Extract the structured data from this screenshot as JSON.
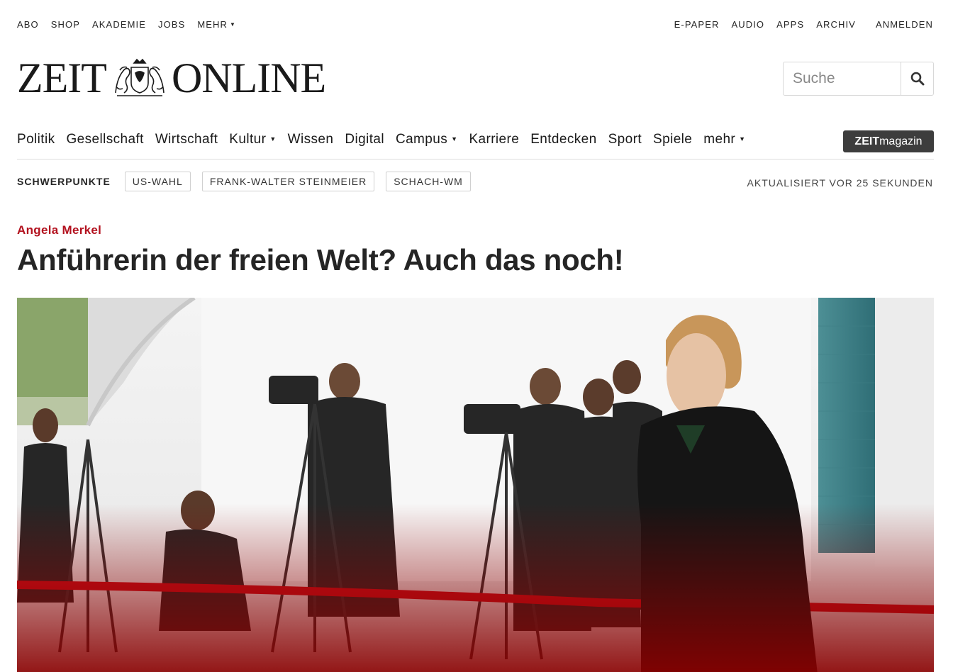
{
  "topbar": {
    "left": [
      "ABO",
      "SHOP",
      "AKADEMIE",
      "JOBS",
      "MEHR"
    ],
    "right": [
      "E-PAPER",
      "AUDIO",
      "APPS",
      "ARCHIV"
    ],
    "login": "ANMELDEN"
  },
  "logo": {
    "left": "ZEIT",
    "right": "ONLINE"
  },
  "search": {
    "placeholder": "Suche"
  },
  "nav": {
    "items": [
      "Politik",
      "Gesellschaft",
      "Wirtschaft",
      "Kultur",
      "Wissen",
      "Digital",
      "Campus",
      "Karriere",
      "Entdecken",
      "Sport",
      "Spiele",
      "mehr"
    ],
    "zeitmagazin_bold": "ZEIT",
    "zeitmagazin_rest": "magazin"
  },
  "topics": {
    "label": "SCHWERPUNKTE",
    "chips": [
      "US-WAHL",
      "FRANK-WALTER STEINMEIER",
      "SCHACH-WM"
    ],
    "updated": "AKTUALISIERT VOR 25 SEKUNDEN"
  },
  "article": {
    "kicker": "Angela Merkel",
    "headline": "Anführerin der freien Welt? Auch das noch!"
  },
  "colors": {
    "accent": "#b3121f",
    "text": "#252525",
    "zeitmagazin_bg": "#3d3d3d"
  },
  "icons": {
    "search": "search-icon",
    "caret": "caret-down-icon",
    "crest": "zeit-crest-icon"
  }
}
